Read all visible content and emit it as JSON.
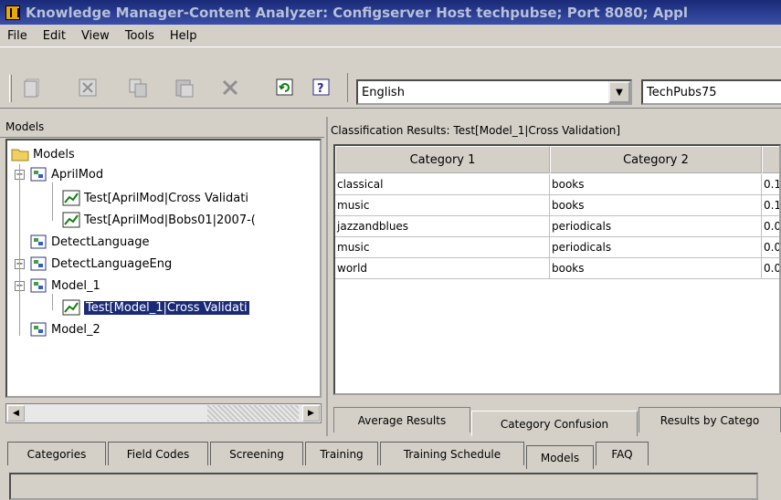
{
  "window": {
    "title": "Knowledge Manager-Content Analyzer: Configserver Host techpubse; Port 8080; Appl"
  },
  "menu": [
    "File",
    "Edit",
    "View",
    "Tools",
    "Help"
  ],
  "toolbar": {
    "language": "English",
    "server": "TechPubs75"
  },
  "models_pane": {
    "header": "Models",
    "tree": [
      {
        "label": "Models",
        "level": 0,
        "icon": "folder-icon"
      },
      {
        "label": "AprilMod",
        "level": 1,
        "icon": "model-icon",
        "expander": "-"
      },
      {
        "label": "Test[AprilMod|Cross Validati",
        "level": 2,
        "icon": "chart-icon"
      },
      {
        "label": "Test[AprilMod|Bobs01|2007-(",
        "level": 2,
        "icon": "chart-icon"
      },
      {
        "label": "DetectLanguage",
        "level": 1,
        "icon": "model-icon"
      },
      {
        "label": "DetectLanguageEng",
        "level": 1,
        "icon": "model-icon",
        "expander": "+"
      },
      {
        "label": "Model_1",
        "level": 1,
        "icon": "model-icon",
        "expander": "-"
      },
      {
        "label": "Test[Model_1|Cross Validati",
        "level": 2,
        "icon": "chart-icon",
        "selected": true
      },
      {
        "label": "Model_2",
        "level": 1,
        "icon": "model-icon"
      }
    ]
  },
  "results_pane": {
    "header": "Classification Results: Test[Model_1|Cross Validation]",
    "columns": [
      "Category 1",
      "Category 2",
      ""
    ],
    "rows": [
      [
        "classical",
        "books",
        "0.1"
      ],
      [
        "music",
        "books",
        "0.1"
      ],
      [
        "jazzandblues",
        "periodicals",
        "0.0"
      ],
      [
        "music",
        "periodicals",
        "0.0"
      ],
      [
        "world",
        "books",
        "0.0"
      ]
    ],
    "tabs": [
      "Average Results",
      "Category Confusion",
      "Results by Catego"
    ],
    "active_tab": "Category Confusion"
  },
  "bottom_tabs": [
    "Categories",
    "Field Codes",
    "Screening",
    "Training",
    "Training Schedule",
    "Models",
    "FAQ"
  ],
  "active_bottom_tab": "Models",
  "colors": {
    "selection": "#1a2a78",
    "titlebar": "#2a3c90"
  }
}
